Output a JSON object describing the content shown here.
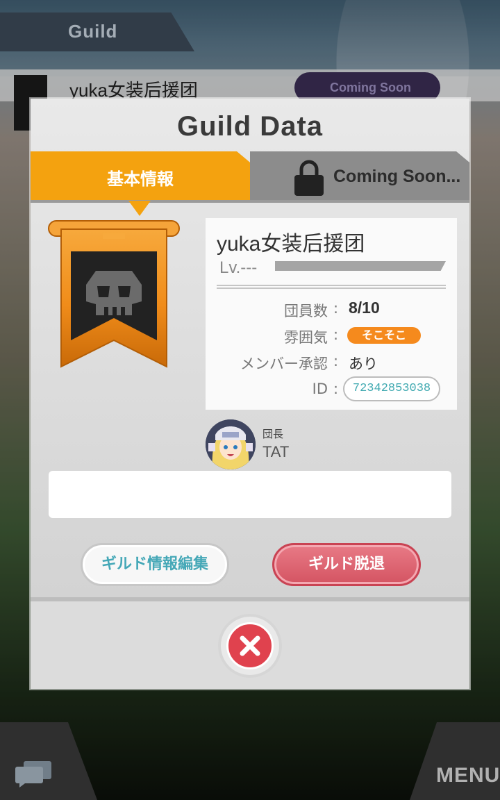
{
  "background": {
    "header_label": "Guild",
    "guild_name": "yuka女装后援团",
    "coming_soon": "Coming Soon",
    "menu_label": "MENU"
  },
  "modal": {
    "title": "Guild Data",
    "tabs": [
      {
        "label": "基本情報",
        "active": true
      },
      {
        "label": "Coming Soon...",
        "locked": true
      }
    ],
    "guild": {
      "name": "yuka女装后援团",
      "level": "Lv.---",
      "rows": [
        {
          "label": "団員数",
          "value": "8/10"
        },
        {
          "label": "雰囲気",
          "value": "そこそこ"
        },
        {
          "label": "メンバー承認",
          "value": "あり"
        },
        {
          "label": "ID",
          "value": "72342853038"
        }
      ]
    },
    "leader": {
      "role": "団長",
      "name": "TAT"
    },
    "comment": "",
    "buttons": {
      "edit": "ギルド情報編集",
      "leave": "ギルド脱退"
    }
  },
  "colors": {
    "accent_orange": "#f4a20f",
    "badge_orange": "#f58a1d",
    "leave_red": "#d45462",
    "close_red": "#e0424e",
    "teal_text": "#45a8b7"
  },
  "icons": [
    "lock-icon",
    "skull-icon",
    "close-icon",
    "chat-icon",
    "plus-icon"
  ]
}
